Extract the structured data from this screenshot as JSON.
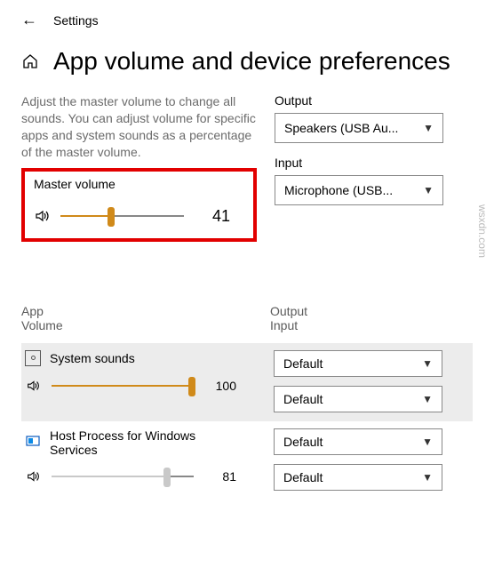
{
  "header": {
    "title": "Settings"
  },
  "page": {
    "title": "App volume and device preferences",
    "description": "Adjust the master volume to change all sounds. You can adjust volume for specific apps and system sounds as a percentage of the master volume."
  },
  "output": {
    "label": "Output",
    "selected": "Speakers (USB Au..."
  },
  "input": {
    "label": "Input",
    "selected": "Microphone (USB..."
  },
  "master": {
    "label": "Master volume",
    "value": 41
  },
  "table": {
    "header_left1": "App",
    "header_left2": "Volume",
    "header_right1": "Output",
    "header_right2": "Input"
  },
  "apps": [
    {
      "name": "System sounds",
      "volume": 100,
      "output": "Default",
      "input": "Default"
    },
    {
      "name": "Host Process for Windows Services",
      "volume": 81,
      "output": "Default",
      "input": "Default"
    }
  ],
  "watermark": "wsxdn.com"
}
